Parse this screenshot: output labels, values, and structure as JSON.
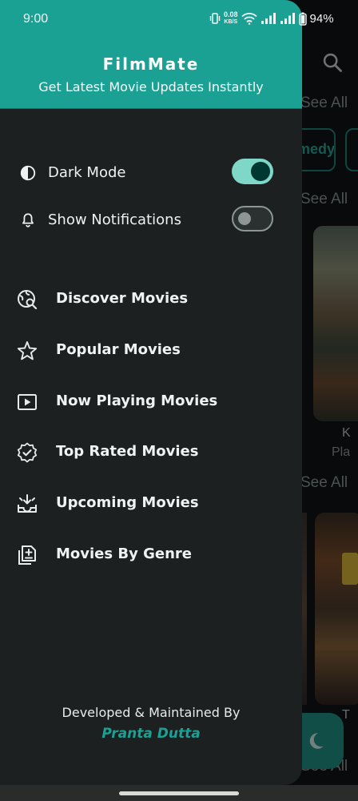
{
  "status_bar": {
    "time": "9:00",
    "net_speed_value": "0.08",
    "net_speed_unit": "KB/S",
    "battery": "94%"
  },
  "background": {
    "see_all_label": "See All",
    "chip_label": "Comedy",
    "poster_title_fragment": "K",
    "poster_subtitle_fragment": "Pla",
    "poster2_title_fragment": "T"
  },
  "drawer": {
    "app_name": "FilmMate",
    "tagline": "Get Latest Movie Updates Instantly",
    "toggles": [
      {
        "label": "Dark Mode",
        "icon": "contrast-icon",
        "on": true
      },
      {
        "label": "Show Notifications",
        "icon": "bell-icon",
        "on": false
      }
    ],
    "nav_items": [
      {
        "label": "Discover Movies",
        "icon": "travel-explore-icon"
      },
      {
        "label": "Popular Movies",
        "icon": "star-outline-icon"
      },
      {
        "label": "Now Playing Movies",
        "icon": "play-box-icon"
      },
      {
        "label": "Top Rated Movies",
        "icon": "verified-badge-icon"
      },
      {
        "label": "Upcoming Movies",
        "icon": "inbox-download-icon"
      },
      {
        "label": "Movies By Genre",
        "icon": "library-add-icon"
      }
    ],
    "footer": {
      "title": "Developed & Maintained By",
      "author": "Pranta Dutta"
    }
  },
  "colors": {
    "accent": "#1ba194",
    "drawer_bg": "#1c2020",
    "switch_on": "#7fd7c8"
  }
}
